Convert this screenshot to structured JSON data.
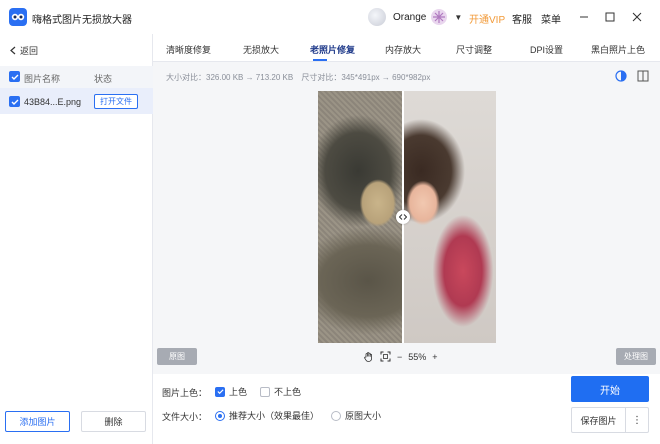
{
  "app": {
    "title": "嗨格式图片无损放大器",
    "user_name": "Orange",
    "vip_label": "开通VIP",
    "service_label": "客服",
    "menu_label": "菜单",
    "accent": "#2a6ff2",
    "vip_color": "#f29a38"
  },
  "sidebar": {
    "back_label": "返回",
    "col_name": "图片名称",
    "col_status": "状态",
    "files": [
      {
        "name": "43B84...E.png",
        "action": "打开文件",
        "checked": true
      }
    ],
    "add_label": "添加图片",
    "delete_label": "删除"
  },
  "tabs": [
    {
      "label": "清晰度修复",
      "active": false
    },
    {
      "label": "无损放大",
      "active": false
    },
    {
      "label": "老照片修复",
      "active": true
    },
    {
      "label": "内存放大",
      "active": false
    },
    {
      "label": "尺寸调整",
      "active": false
    },
    {
      "label": "DPI设置",
      "active": false
    },
    {
      "label": "黑白照片上色",
      "active": false
    }
  ],
  "info": {
    "size_compare": "大小对比：326.00 KB → 713.20 KB",
    "dim_compare": "尺寸对比：345*491px → 690*982px"
  },
  "preview": {
    "original_label": "原图",
    "processed_label": "处理图",
    "zoom": "55%"
  },
  "options": {
    "colorize_label": "图片上色：",
    "colorize_on": "上色",
    "colorize_off": "不上色",
    "colorize_value": "上色",
    "filesize_label": "文件大小：",
    "filesize_recommended": "推荐大小（效果最佳）",
    "filesize_original": "原图大小",
    "filesize_value": "推荐大小（效果最佳）"
  },
  "actions": {
    "start_label": "开始",
    "save_label": "保存图片",
    "more_label": "⋮"
  }
}
